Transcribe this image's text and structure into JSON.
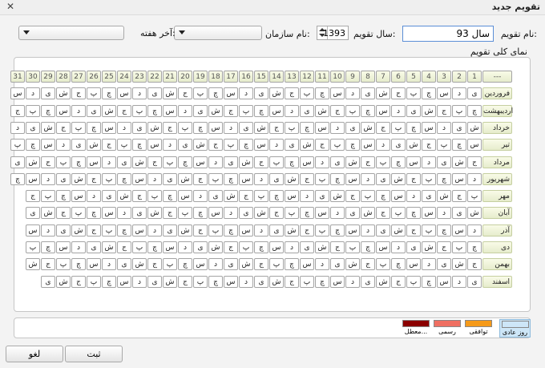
{
  "window": {
    "title": "تقویم جدید"
  },
  "form": {
    "name_label": "نام تقویم:",
    "name_value": "سال 93",
    "year_label": "سال تقویم:",
    "year_value": "1393",
    "org_label": "نام سازمان:",
    "weekend_label": "آخر هفته:"
  },
  "grid": {
    "title": "نمای کلی تقویم",
    "corner": "---",
    "days": [
      "1",
      "2",
      "3",
      "4",
      "5",
      "6",
      "7",
      "8",
      "9",
      "10",
      "11",
      "12",
      "13",
      "14",
      "15",
      "16",
      "17",
      "18",
      "19",
      "20",
      "21",
      "22",
      "23",
      "24",
      "25",
      "26",
      "27",
      "28",
      "29",
      "30",
      "31"
    ],
    "months": [
      {
        "name": "فروردین",
        "start": 1,
        "count": 31
      },
      {
        "name": "اردیبهشت",
        "start": 4,
        "count": 31
      },
      {
        "name": "خرداد",
        "start": 0,
        "count": 31
      },
      {
        "name": "تیر",
        "start": 3,
        "count": 31
      },
      {
        "name": "مرداد",
        "start": 6,
        "count": 31
      },
      {
        "name": "شهریور",
        "start": 2,
        "count": 31
      },
      {
        "name": "مهر",
        "start": 5,
        "count": 30
      },
      {
        "name": "آبان",
        "start": 0,
        "count": 30
      },
      {
        "name": "آذر",
        "start": 2,
        "count": 30
      },
      {
        "name": "دی",
        "start": 4,
        "count": 30
      },
      {
        "name": "بهمن",
        "start": 6,
        "count": 30
      },
      {
        "name": "اسفند",
        "start": 1,
        "count": 29
      }
    ],
    "weekdays": [
      "ش",
      "ی",
      "د",
      "س",
      "چ",
      "پ",
      "ج"
    ]
  },
  "legend": [
    {
      "label": "روز عادی",
      "color": "#cde6f7"
    },
    {
      "label": "توافقی",
      "color": "#f59a1a"
    },
    {
      "label": "رسمی",
      "color": "#ef6f62"
    },
    {
      "label": "معطل...",
      "color": "#8b0000"
    }
  ],
  "buttons": {
    "save": "ثبت",
    "cancel": "لغو"
  }
}
